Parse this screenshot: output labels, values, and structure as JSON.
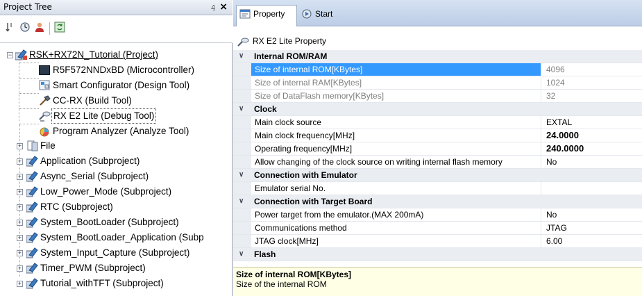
{
  "tree_panel": {
    "title": "Project Tree",
    "pin_glyph": "Ԅ",
    "close_glyph": "✕",
    "toolbar": [
      "sort-icon",
      "clock-icon",
      "user-icon",
      "refresh-icon"
    ]
  },
  "tree": {
    "root": "RSK+RX72N_Tutorial (Project)",
    "children": [
      "R5F572NNDxBD (Microcontroller)",
      "Smart Configurator (Design Tool)",
      "CC-RX (Build Tool)",
      "RX E2 Lite (Debug Tool)",
      "Program Analyzer (Analyze Tool)",
      "File"
    ],
    "subprojects": [
      "Application (Subproject)",
      "Async_Serial (Subproject)",
      "Low_Power_Mode (Subproject)",
      "RTC (Subproject)",
      "System_BootLoader (Subproject)",
      "System_BootLoader_Application (Subp",
      "System_Input_Capture (Subproject)",
      "Timer_PWM (Subproject)",
      "Tutorial_withTFT (Subproject)"
    ]
  },
  "prop_tabs": {
    "property": "Property",
    "start": "Start"
  },
  "prop_header": "RX E2 Lite Property",
  "grid": {
    "cat1": "Internal ROM/RAM",
    "rom_lbl": "Size of internal ROM[KBytes]",
    "rom_val": "4096",
    "ram_lbl": "Size of internal RAM[KBytes]",
    "ram_val": "1024",
    "df_lbl": "Size of DataFlash memory[KBytes]",
    "df_val": "32",
    "cat2": "Clock",
    "mcs_lbl": "Main clock source",
    "mcs_val": "EXTAL",
    "mcf_lbl": "Main clock frequency[MHz]",
    "mcf_val": "24.0000",
    "opf_lbl": "Operating frequency[MHz]",
    "opf_val": "240.0000",
    "acc_lbl": "Allow changing of the clock source on writing internal flash memory",
    "acc_val": "No",
    "cat3": "Connection with Emulator",
    "esn_lbl": "Emulator serial No.",
    "esn_val": "",
    "cat4": "Connection with Target Board",
    "pwr_lbl": "Power target from the emulator.(MAX 200mA)",
    "pwr_val": "No",
    "com_lbl": "Communications method",
    "com_val": "JTAG",
    "jtag_lbl": "JTAG clock[MHz]",
    "jtag_val": "6.00",
    "cat5": "Flash"
  },
  "description": {
    "title": "Size of internal ROM[KBytes]",
    "text": "Size of the internal ROM"
  },
  "colors": {
    "selection": "#3399ff",
    "category_bg": "#eaeef3",
    "desc_bg": "#ffffe6"
  }
}
